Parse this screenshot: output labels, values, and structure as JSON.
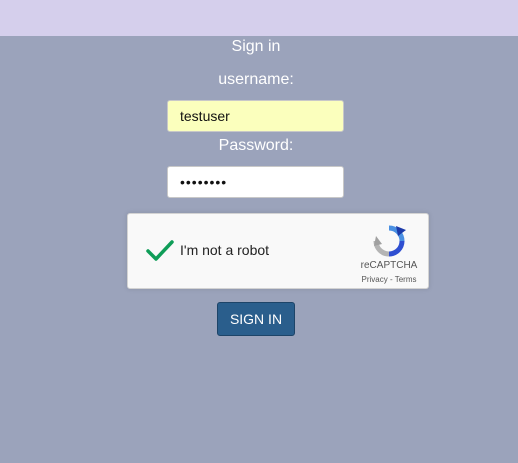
{
  "form": {
    "title": "Sign in",
    "username_label": "username:",
    "username_value": "testuser",
    "password_label": "Password:",
    "password_value": "••••••••",
    "submit_label": "SIGN IN"
  },
  "recaptcha": {
    "checkbox_label": "I'm not a robot",
    "checked": true,
    "brand": "reCAPTCHA",
    "privacy_label": "Privacy",
    "separator": " - ",
    "terms_label": "Terms",
    "check_icon": "checkmark-icon",
    "logo_icon": "recaptcha-logo-icon"
  },
  "colors": {
    "background": "#9ba3bb",
    "top_band": "#d5cfec",
    "autofill_input": "#fbffbd",
    "button": "#2a5e8c",
    "check": "#0f9d58"
  }
}
